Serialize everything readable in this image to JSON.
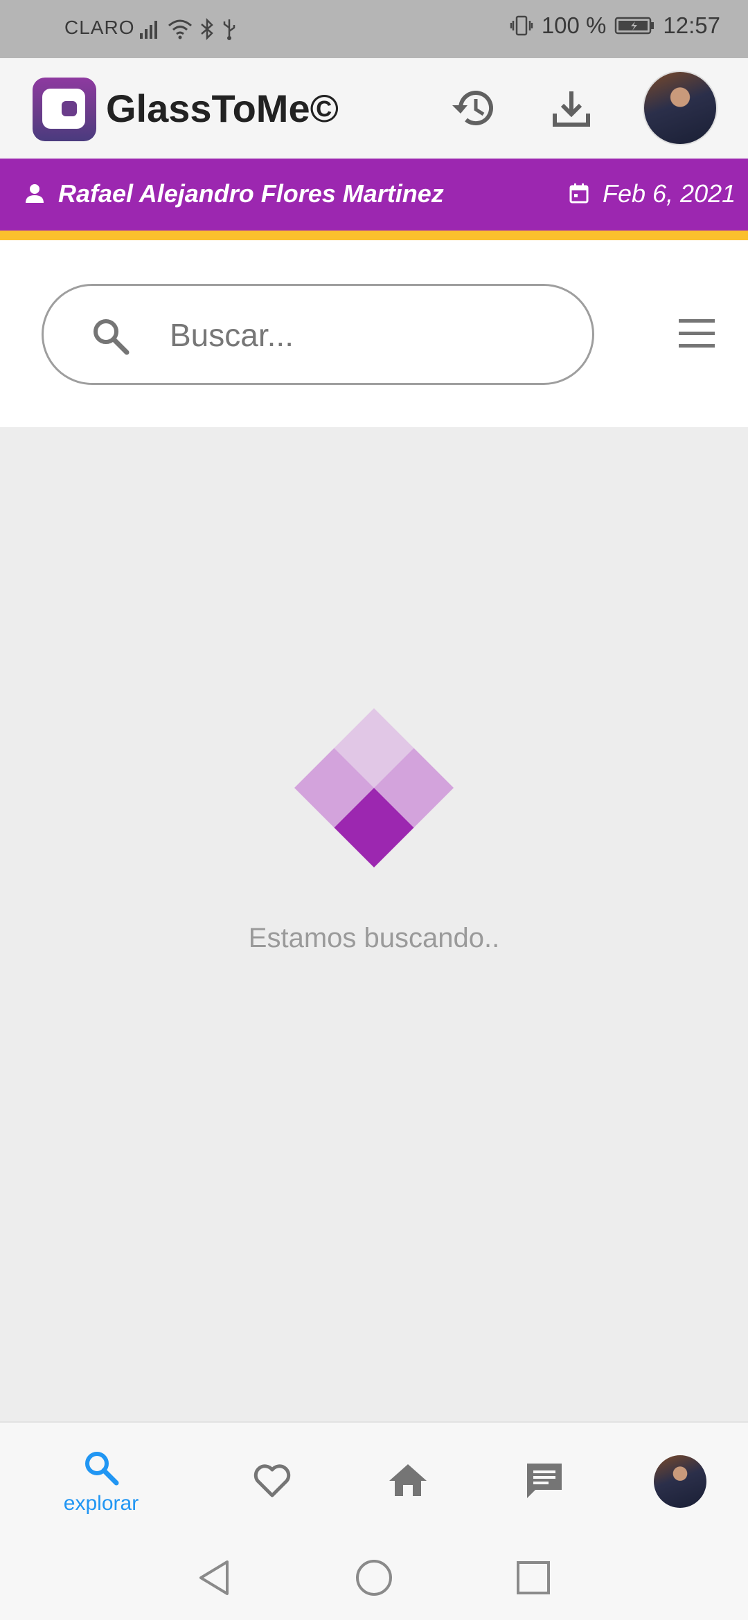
{
  "status_bar": {
    "carrier": "CLARO",
    "battery": "100 %",
    "time": "12:57",
    "icons": [
      "signal-icon",
      "wifi-icon",
      "bluetooth-icon",
      "usb-icon",
      "vibrate-icon",
      "battery-icon"
    ]
  },
  "header": {
    "app_name": "GlassToMe©",
    "icons": [
      "app-logo",
      "history-icon",
      "download-icon",
      "profile-avatar"
    ]
  },
  "user_bar": {
    "name": "Rafael Alejandro Flores Martinez",
    "date": "Feb 6, 2021",
    "background": "#9c27b0",
    "accent": "#fbc02d"
  },
  "search": {
    "placeholder": "Buscar...",
    "value": ""
  },
  "loading": {
    "text": "Estamos buscando..",
    "colors": [
      "#e1c7e6",
      "#d3a3dc",
      "#9c27b0"
    ]
  },
  "bottom_nav": {
    "items": [
      {
        "icon": "search-icon",
        "label": "explorar",
        "active": true
      },
      {
        "icon": "heart-icon",
        "label": "",
        "active": false
      },
      {
        "icon": "home-icon",
        "label": "",
        "active": false
      },
      {
        "icon": "chat-icon",
        "label": "",
        "active": false
      },
      {
        "icon": "profile-avatar",
        "label": "",
        "active": false
      }
    ],
    "active_color": "#2196f3"
  },
  "system_nav": [
    "back-icon",
    "home-circle-icon",
    "recents-icon"
  ]
}
